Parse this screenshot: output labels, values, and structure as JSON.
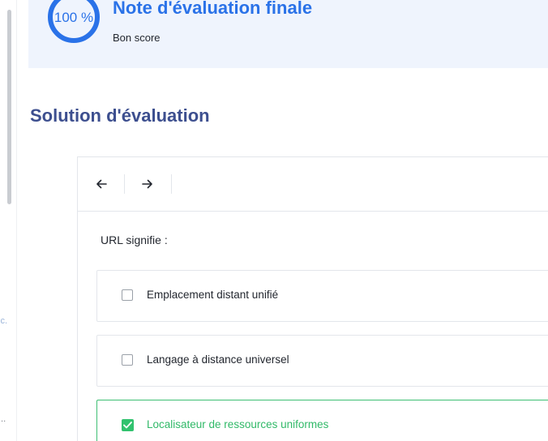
{
  "sidebar": {
    "cropped_text_1": "ic.",
    "cropped_text_2": "..."
  },
  "score": {
    "value": "100 %",
    "percent": 100,
    "title": "Note d'évaluation finale",
    "subtitle": "Bon score"
  },
  "section": {
    "title": "Solution d'évaluation"
  },
  "toolbar": {
    "prev_icon": "arrow-left-icon",
    "next_icon": "arrow-right-icon"
  },
  "question": {
    "text": "URL signifie :",
    "options": [
      {
        "label": "Emplacement distant unifié",
        "checked": false
      },
      {
        "label": "Langage à distance universel",
        "checked": false
      },
      {
        "label": "Localisateur de ressources uniformes",
        "checked": true
      }
    ]
  },
  "colors": {
    "accent": "#2a72e8",
    "heading": "#3d4f8f",
    "correct": "#31c26e",
    "banner_bg": "#eff4fd"
  }
}
